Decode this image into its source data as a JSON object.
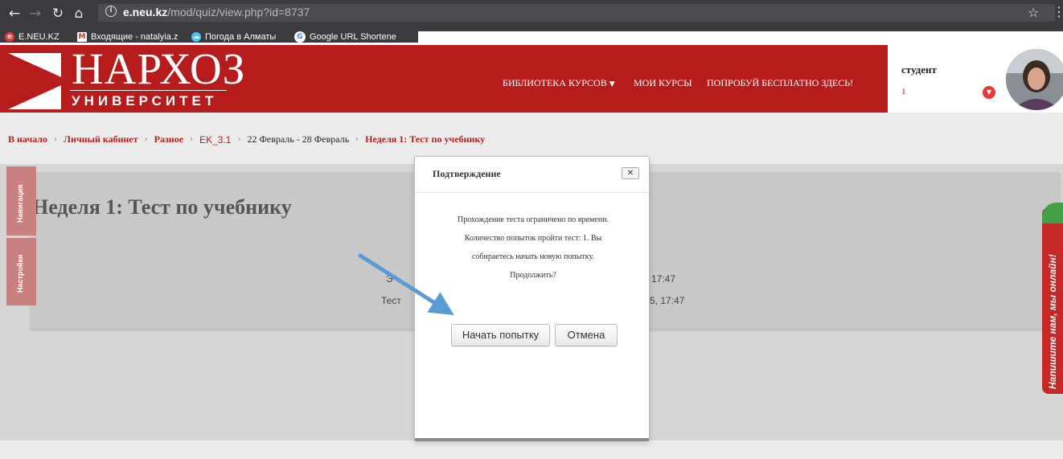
{
  "browser": {
    "url_host": "e.neu.kz",
    "url_path": "/mod/quiz/view.php?id=8737",
    "bookmarks": [
      {
        "label": "E.NEU.KZ",
        "icon": "e-neu-favicon",
        "color": "#e53935"
      },
      {
        "label": "Входящие - natalyia.z",
        "icon": "gmail-icon",
        "color": "#d93025"
      },
      {
        "label": "Погода в Алматы",
        "icon": "weather-icon",
        "color": "#4fc3f7"
      },
      {
        "label": "Google URL Shortene",
        "icon": "google-icon",
        "color": "#4285f4"
      }
    ]
  },
  "header": {
    "logo_title": "НАРХОЗ",
    "logo_subtitle": "УНИВЕРСИТЕТ",
    "nav": [
      {
        "label": "Библиотека курсов",
        "has_caret": true
      },
      {
        "label": "Мои курсы",
        "has_caret": false
      },
      {
        "label": "Попробуй бесплатно здесь!",
        "has_caret": false
      }
    ],
    "user": {
      "role": "студент",
      "count": "1"
    },
    "brand_color": "#b71c1c"
  },
  "breadcrumbs": [
    {
      "label": "В начало",
      "style": "red"
    },
    {
      "label": "Личный кабинет",
      "style": "red"
    },
    {
      "label": "Разное",
      "style": "red"
    },
    {
      "label": "EK_3.1",
      "style": "red"
    },
    {
      "label": "22 Февраль - 28 Февраль",
      "style": "dark"
    },
    {
      "label": "Неделя 1: Тест по учебнику",
      "style": "red"
    }
  ],
  "sidebar_tabs": [
    "Навигация",
    "Настройки"
  ],
  "page": {
    "title": "Неделя 1: Тест по учебнику",
    "partial_lines": [
      "Э",
      "Тест",
      "17:47",
      "5, 17:47"
    ]
  },
  "chat_widget": {
    "label": "Напишите нам, мы онлайн!"
  },
  "modal": {
    "title": "Подтверждение",
    "close_label": "✕",
    "body_lines": [
      "Прохождение теста ограничено по времени.",
      "Количество попыток пройти тест: 1. Вы",
      "собираетесь начать новую попытку.",
      "Продолжить?"
    ],
    "start_button": "Начать попытку",
    "cancel_button": "Отмена"
  },
  "annotation": {
    "arrow_color": "#5b9bd5"
  }
}
